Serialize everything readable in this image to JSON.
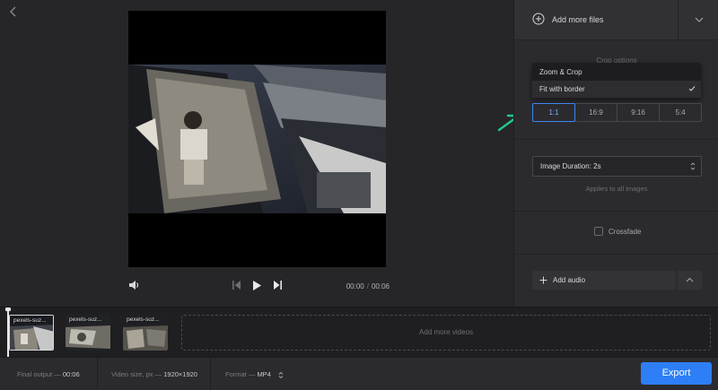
{
  "header": {
    "add_files_label": "Add more files"
  },
  "crop": {
    "title": "Crop options",
    "options": [
      "Zoom & Crop",
      "Fit with border"
    ],
    "selected_option": "Fit with border",
    "ratios": [
      "1:1",
      "16:9",
      "9:16",
      "5:4"
    ],
    "active_ratio": "1:1"
  },
  "duration": {
    "value": "Image Duration: 2s",
    "hint": "Applies to all images"
  },
  "crossfade": {
    "label": "Crossfade",
    "checked": false
  },
  "audio": {
    "label": "Add audio"
  },
  "player": {
    "current_time": "00:00",
    "separator": "/",
    "duration": "00:06"
  },
  "timeline": {
    "clips": [
      {
        "name": "pexels-suz..."
      },
      {
        "name": "pexels-suz..."
      },
      {
        "name": "pexels-suz..."
      }
    ],
    "add_more_label": "Add more videos"
  },
  "footer": {
    "final_output_label": "Final output —",
    "final_output_value": "00:06",
    "video_size_label": "Video size, px —",
    "video_size_value": "1920×1920",
    "format_label": "Format —",
    "format_value": "MP4",
    "export_label": "Export"
  },
  "colors": {
    "accent": "#2d7ef7",
    "annotation_arrow": "#1fc98a"
  }
}
